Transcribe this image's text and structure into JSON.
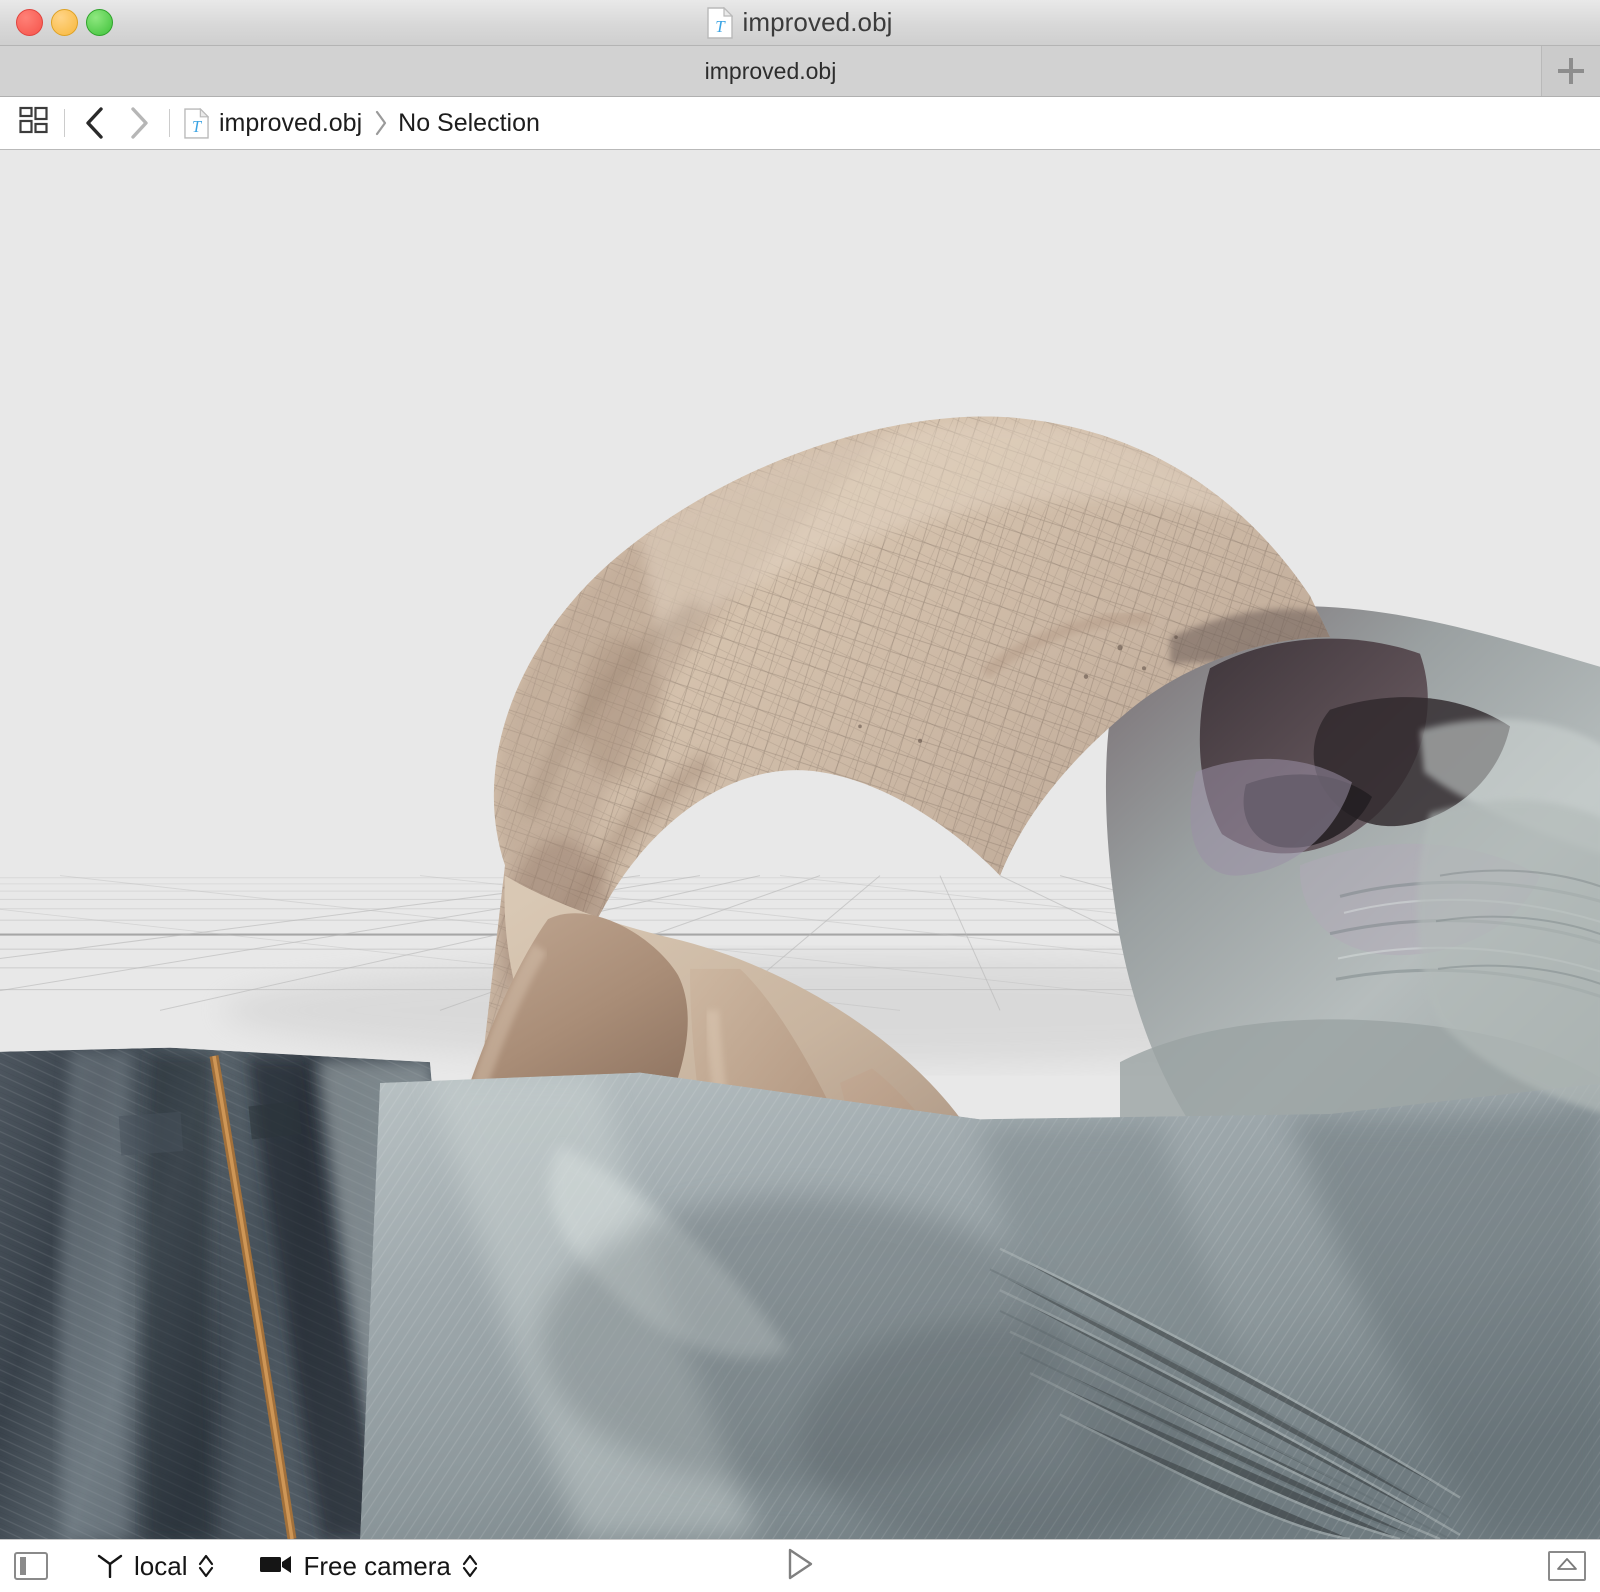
{
  "window": {
    "title": "improved.obj",
    "title_icon": "document-text-icon",
    "traffic_lights": [
      {
        "name": "close",
        "color": "#f5534a"
      },
      {
        "name": "minimize",
        "color": "#f7b73c"
      },
      {
        "name": "maximize",
        "color": "#3fc13a"
      }
    ]
  },
  "tabbar": {
    "tabs": [
      {
        "label": "improved.obj"
      }
    ],
    "add_tab_icon": "plus-icon"
  },
  "jumpbar": {
    "related_items_icon": "four-squares-icon",
    "back_icon": "chevron-left-icon",
    "forward_icon": "chevron-right-icon",
    "file_icon": "document-text-icon",
    "crumbs": [
      "improved.obj",
      "No Selection"
    ],
    "crumb_separator": "chevron-right-icon"
  },
  "viewport": {
    "background_color": "#e8e8e8",
    "grid": {
      "visible": true,
      "line_color": "#8f8f8f"
    },
    "model_name": "improved.obj",
    "description": "photogrammetry-scanned arm and hand resting on denim jeans"
  },
  "bottombar": {
    "sidebar_toggle_icon": "sidebar-toggle-icon",
    "transform_space": {
      "icon": "axis-tripod-icon",
      "value": "local",
      "stepper_icon": "up-down-chevrons-icon"
    },
    "camera": {
      "icon": "video-camera-icon",
      "value": "Free camera",
      "stepper_icon": "up-down-chevrons-icon"
    },
    "play_icon": "play-triangle-icon",
    "mesh_stats_icon": "triangle-in-box-icon"
  },
  "colors": {
    "titlebar_top": "#e9e9e9",
    "titlebar_bottom": "#cfcfcf",
    "tabbar": "#d2d2d2",
    "jumpbar": "#ffffff",
    "viewport": "#e8e8e8",
    "bottombar": "#ffffff",
    "accent_blue": "#3aa3e3",
    "text_primary": "#1d1d1d",
    "icon_grey": "#8a8a8a"
  }
}
